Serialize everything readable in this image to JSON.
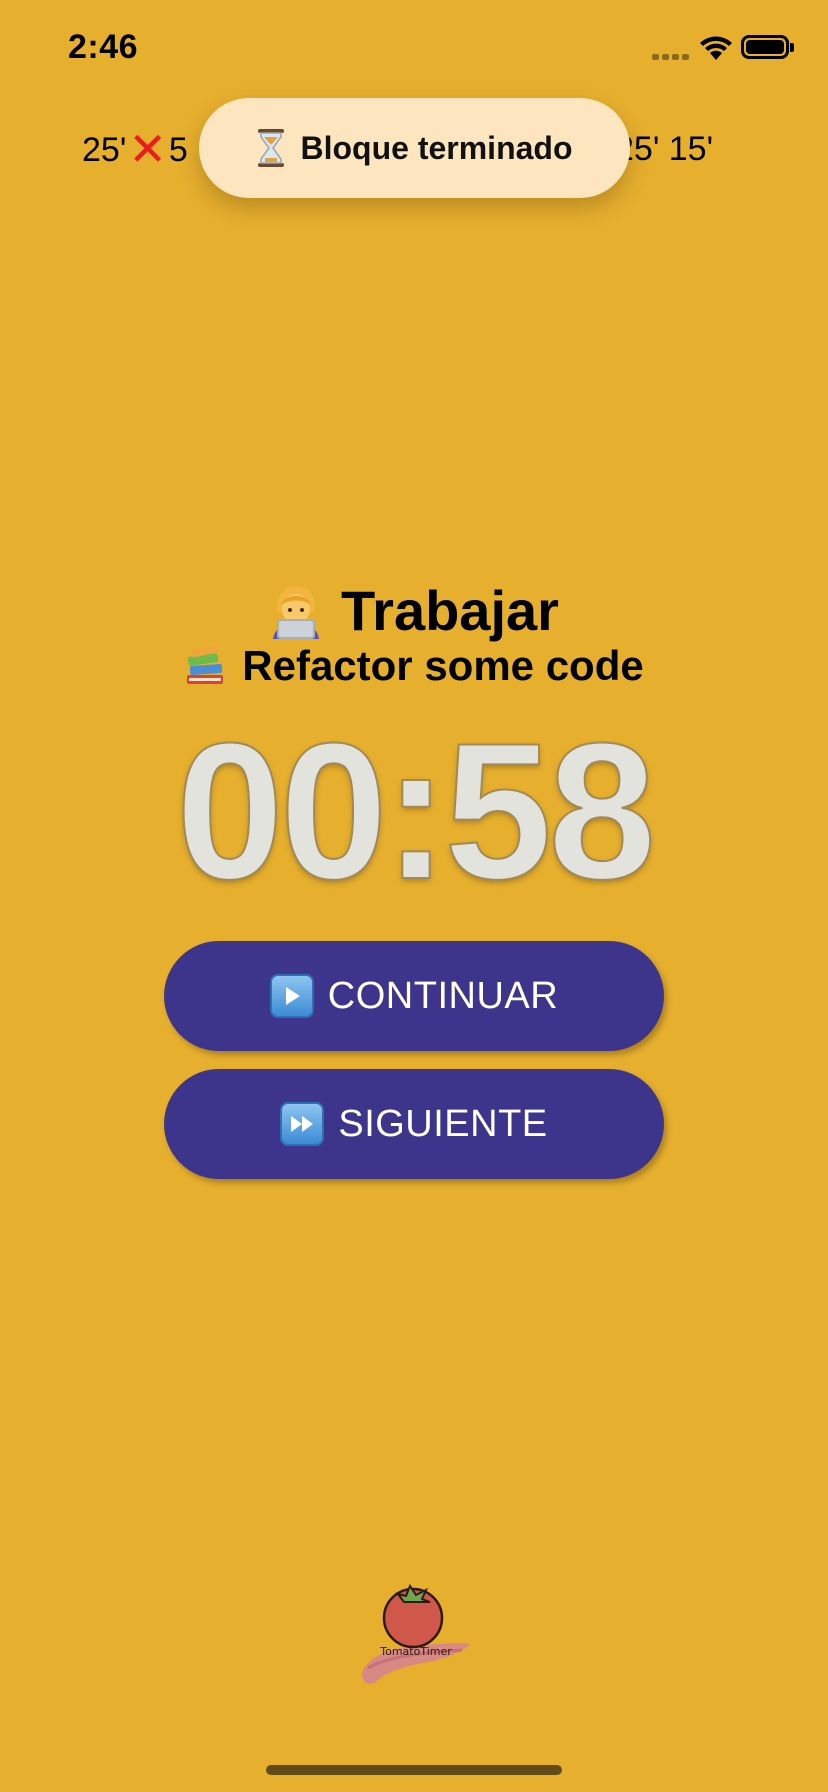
{
  "status_bar": {
    "time": "2:46"
  },
  "history": {
    "left_text": "25'",
    "left_after_icon": "5",
    "right_text": "25' 15'"
  },
  "toast": {
    "icon": "hourglass-icon",
    "label": "Bloque terminado"
  },
  "task": {
    "title_icon": "woman-technologist-icon",
    "title": "Trabajar",
    "subtitle_icon": "books-icon",
    "subtitle": "Refactor some code"
  },
  "timer": {
    "display": "00:58"
  },
  "buttons": {
    "continue": {
      "icon": "play-icon",
      "label": "CONTINUAR"
    },
    "next": {
      "icon": "fast-forward-icon",
      "label": "SIGUIENTE"
    }
  },
  "logo": {
    "name": "tomato-timer-logo"
  },
  "colors": {
    "background": "#E6AF2E",
    "button": "#3C358B",
    "toast": "#FDE5C0",
    "timer_text": "#E3E3DD",
    "logo_tomato": "#D0584B"
  }
}
